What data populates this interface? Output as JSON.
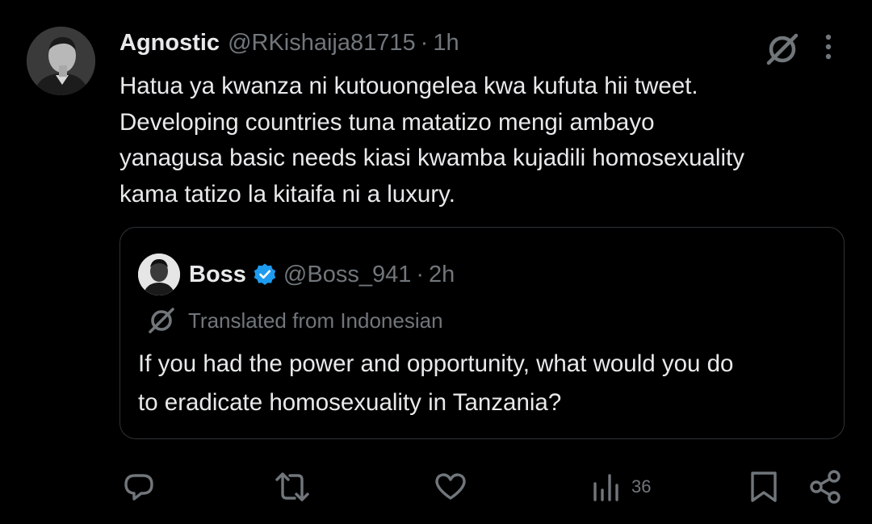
{
  "tweet": {
    "author_name": "Agnostic",
    "handle": "@RKishaija81715",
    "separator": "·",
    "time": "1h",
    "text_lines": [
      "Hatua ya kwanza ni kutouongelea kwa kufuta hii tweet.",
      "Developing countries tuna matatizo mengi ambayo",
      "yanagusa basic needs kiasi kwamba kujadili homosexuality",
      "kama tatizo la kitaifa ni a luxury."
    ]
  },
  "quoted": {
    "author_name": "Boss",
    "handle": "@Boss_941",
    "separator": "·",
    "time": "2h",
    "translated_label": "Translated from Indonesian",
    "text_lines": [
      "If you had the power and opportunity, what would you do",
      "to eradicate homosexuality in Tanzania?"
    ]
  },
  "actions": {
    "views_count": "36"
  },
  "colors": {
    "background": "#000000",
    "text": "#e7e9ea",
    "muted": "#71767b",
    "verified": "#1d9bf0",
    "border": "#2f3336"
  },
  "icons": [
    "grok-icon",
    "more-icon",
    "verified-icon",
    "translate-icon",
    "reply-icon",
    "retweet-icon",
    "like-icon",
    "views-icon",
    "bookmark-icon",
    "share-icon"
  ]
}
